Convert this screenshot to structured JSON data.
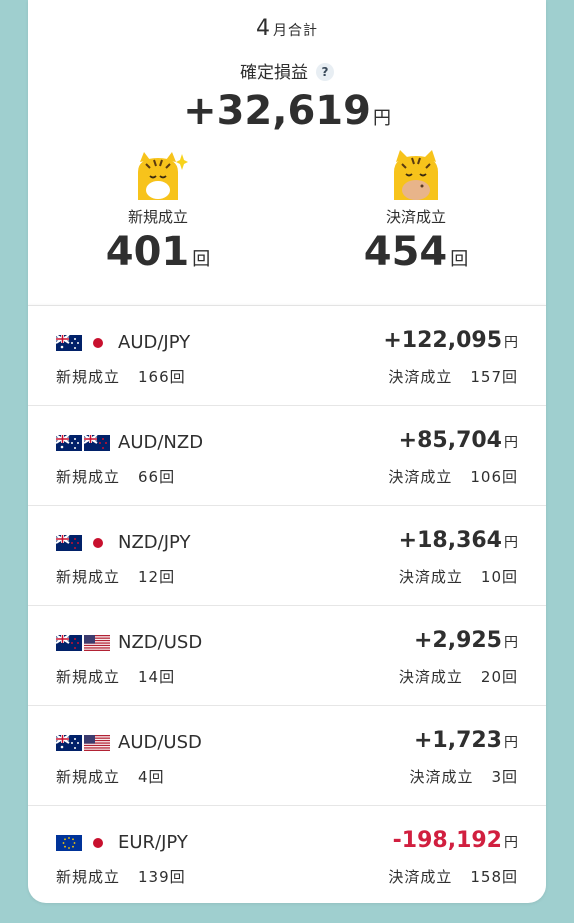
{
  "summary": {
    "month_num": "4",
    "month_suffix": "月合計",
    "profit_label": "確定損益",
    "help_glyph": "?",
    "profit_value": "+32,619",
    "yen": "円",
    "new_label": "新規成立",
    "new_count": "401",
    "close_label": "決済成立",
    "close_count": "454",
    "count_unit": "回"
  },
  "colors": {
    "background": "#9fcfcf",
    "negative": "#d11f3f"
  },
  "pairs": [
    {
      "flags": [
        "au",
        "jp"
      ],
      "pair": "AUD/JPY",
      "pl": "+122,095",
      "new_label": "新規成立",
      "new": "166回",
      "close_label": "決済成立",
      "close": "157回",
      "negative": false
    },
    {
      "flags": [
        "au",
        "nz"
      ],
      "pair": "AUD/NZD",
      "pl": "+85,704",
      "new_label": "新規成立",
      "new": "66回",
      "close_label": "決済成立",
      "close": "106回",
      "negative": false
    },
    {
      "flags": [
        "nz",
        "jp"
      ],
      "pair": "NZD/JPY",
      "pl": "+18,364",
      "new_label": "新規成立",
      "new": "12回",
      "close_label": "決済成立",
      "close": "10回",
      "negative": false
    },
    {
      "flags": [
        "nz",
        "us"
      ],
      "pair": "NZD/USD",
      "pl": "+2,925",
      "new_label": "新規成立",
      "new": "14回",
      "close_label": "決済成立",
      "close": "20回",
      "negative": false
    },
    {
      "flags": [
        "au",
        "us"
      ],
      "pair": "AUD/USD",
      "pl": "+1,723",
      "new_label": "新規成立",
      "new": "4回",
      "close_label": "決済成立",
      "close": "3回",
      "negative": false
    },
    {
      "flags": [
        "eu",
        "jp"
      ],
      "pair": "EUR/JPY",
      "pl": "-198,192",
      "new_label": "新規成立",
      "new": "139回",
      "close_label": "決済成立",
      "close": "158回",
      "negative": true
    }
  ]
}
